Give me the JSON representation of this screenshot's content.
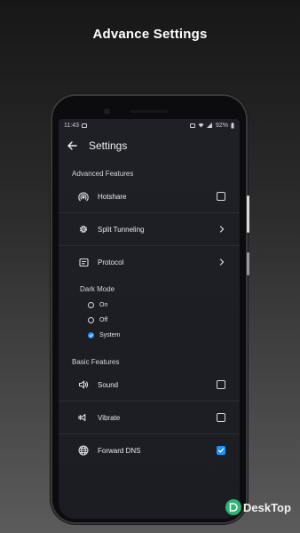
{
  "promo": {
    "title": "Advance Settings"
  },
  "status_bar": {
    "time": "11:43",
    "battery": "92%"
  },
  "app_bar": {
    "title": "Settings"
  },
  "advanced_features": {
    "title": "Advanced Features",
    "items": [
      {
        "label": "Hotshare",
        "icon": "hotspot-icon",
        "control": "checkbox",
        "checked": false
      },
      {
        "label": "Split Tunneling",
        "icon": "gear-icon",
        "control": "chevron"
      },
      {
        "label": "Protocol",
        "icon": "protocol-icon",
        "control": "chevron"
      }
    ]
  },
  "dark_mode": {
    "title": "Dark Mode",
    "options": [
      "On",
      "Off",
      "System"
    ],
    "selected": "System"
  },
  "basic_features": {
    "title": "Basic Features",
    "items": [
      {
        "label": "Sound",
        "icon": "speaker-icon",
        "control": "checkbox",
        "checked": false
      },
      {
        "label": "Vibrate",
        "icon": "vibrate-icon",
        "control": "checkbox",
        "checked": false
      },
      {
        "label": "Forward DNS",
        "icon": "dns-icon",
        "control": "checkbox",
        "checked": true
      }
    ]
  },
  "watermark": {
    "text": "DeskTop"
  },
  "colors": {
    "accent": "#1e90ff",
    "screen_bg": "#1e2026",
    "divider": "#2c2e35"
  }
}
